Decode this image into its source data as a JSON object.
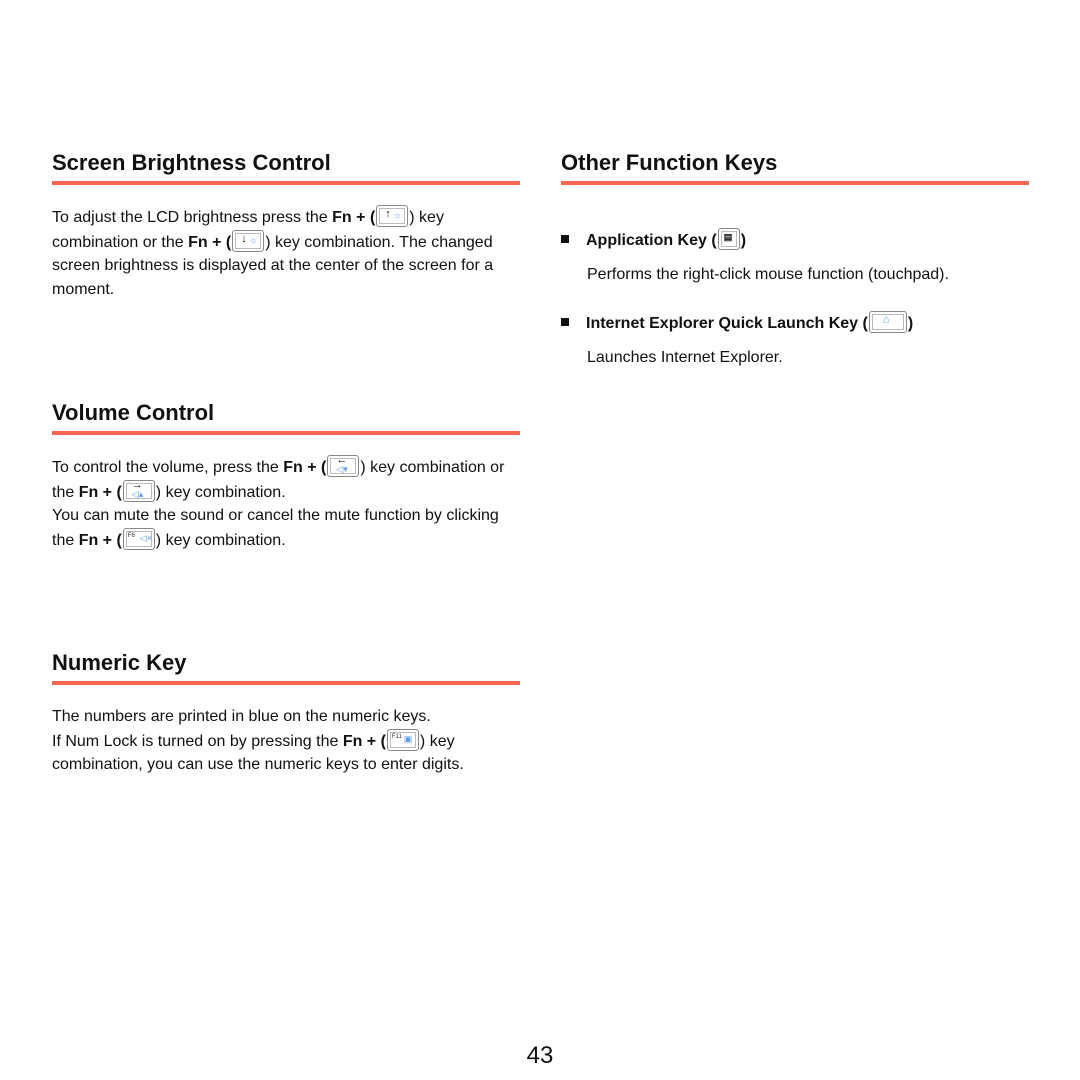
{
  "sections": {
    "brightness": {
      "title": "Screen Brightness Control",
      "p1": "To adjust the LCD brightness press the ",
      "fn": "Fn + (",
      "p2": ") key combination or the ",
      "p3": ") key combination. The changed screen brightness is displayed at the center of the screen for a moment.",
      "key_up_icon": "brightness-up-key-icon",
      "key_down_icon": "brightness-down-key-icon"
    },
    "volume": {
      "title": "Volume Control",
      "p1": "To control the volume, press the ",
      "fn": "Fn + (",
      "p2": ") key combination or the ",
      "p3": ") key combination.",
      "p4": "You can mute the sound or cancel the mute function by clicking the ",
      "p5": ") key combination.",
      "mute_key_label": "F6"
    },
    "numeric": {
      "title": "Numeric Key",
      "p1": "The numbers are printed in blue on the numeric keys.",
      "p2": "If Num Lock is turned on by pressing the ",
      "fn": "Fn + (",
      "p3": ") key combination, you can use the numeric keys to enter digits.",
      "numlock_key_label": "F11"
    },
    "other": {
      "title": "Other Function Keys",
      "items": [
        {
          "head": "Application Key (",
          "close": ")",
          "desc": "Performs the right-click mouse function (touchpad)."
        },
        {
          "head": "Internet Explorer Quick Launch Key (",
          "close": ")",
          "desc": "Launches Internet Explorer."
        }
      ]
    }
  },
  "page_number": "43",
  "colors": {
    "rule": "#fb6650",
    "key_glyph": "#5b9cf0"
  }
}
